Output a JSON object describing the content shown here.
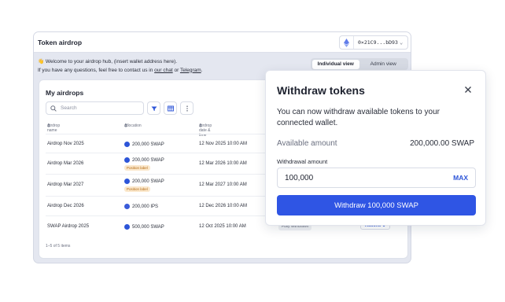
{
  "window": {
    "title": "Token airdrop",
    "wallet_address": "0×21C9...bD93",
    "welcome_line1": "👋 Welcome to your airdrop hub, (insert wallet address here).",
    "welcome_prefix": "If you have any questions, feel free to contact us in ",
    "welcome_link1": "our chat",
    "welcome_or": " or ",
    "welcome_link2": "Telegram",
    "welcome_suffix": ".",
    "tabs": [
      {
        "label": "Individual view",
        "active": true
      },
      {
        "label": "Admin view",
        "active": false
      }
    ]
  },
  "airdrops": {
    "title": "My airdrops",
    "search_placeholder": "Search",
    "columns": [
      "Airdrop name",
      "Allocation",
      "Airdrop date & time"
    ],
    "rows": [
      {
        "name": "Airdrop Nov 2025",
        "allocation": "200,000 SWAP",
        "token": "swap-token-icon",
        "datetime": "12 Nov 2025 10:00 AM",
        "tag": ""
      },
      {
        "name": "Airdrop Mar 2026",
        "allocation": "200,000 SWAP",
        "token": "swap-token-icon",
        "datetime": "12 Mar 2026 10:00 AM",
        "tag": "Position label"
      },
      {
        "name": "Airdrop Mar 2027",
        "allocation": "200,000 SWAP",
        "token": "swap-token-icon",
        "datetime": "12 Mar 2027 10:00 AM",
        "tag": "Position label"
      },
      {
        "name": "Airdrop Dec 2026",
        "allocation": "200,000 IPS",
        "token": "ips-token-icon",
        "datetime": "12 Dec 2026 10:00 AM",
        "tag": ""
      },
      {
        "name": "SWAP Airdrop 2025",
        "allocation": "500,000 SWAP",
        "token": "swap-token-icon",
        "datetime": "12 Oct 2025 10:00 AM",
        "tag": "",
        "status": "Fully withdrawn",
        "action": "Actions"
      }
    ],
    "pager": "1–5 of 5 items"
  },
  "modal": {
    "title": "Withdraw tokens",
    "description": "You can now withdraw available tokens to your connected wallet.",
    "available_label": "Available amount",
    "available_value": "200,000.00 SWAP",
    "field_label": "Withdrawal amount",
    "input_value": "100,000",
    "max_label": "MAX",
    "submit_label": "Withdraw 100,000 SWAP"
  },
  "colors": {
    "accent": "#2f55e4",
    "tag_bg": "#fbe8cc",
    "tag_text": "#b46a12"
  }
}
